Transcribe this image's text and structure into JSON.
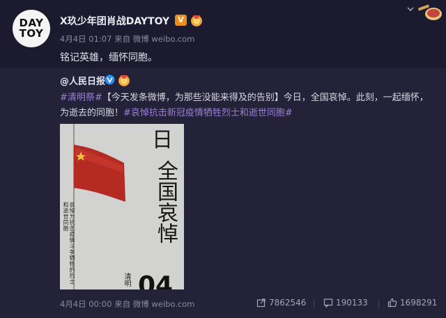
{
  "post": {
    "author": "X玖少年团肖战DAYTOY",
    "avatar_text_line1": "DAY",
    "avatar_text_line2": "TOY",
    "verified_badge": "V",
    "meta": "4月4日 01:07 来自 微博 weibo.com",
    "text": "铭记英雄，缅怀同胞。"
  },
  "repost": {
    "author": "@人民日报",
    "text_tag1": "#清明祭#",
    "text_body": "【今天发条微博，为那些没能来得及的告别】今日，全国哀悼。此刻，一起缅怀，为逝去的同胞！",
    "text_tag2": "#哀悼抗击新冠疫情牺牲烈士和逝世同胞#",
    "poster": {
      "top_char": "日",
      "headline": "全国哀悼",
      "subtitle": "哀悼为抗击疫情斗争牺牲的烈士和逝世同胞",
      "qingming": "清明",
      "number": "04"
    },
    "meta": "4月4日 00:00 来自 微博 weibo.com",
    "stats": {
      "reposts": "7862546",
      "comments": "190133",
      "likes": "1698291"
    }
  },
  "colors": {
    "background": "#1c1a2e",
    "repost_background": "#242238",
    "tag": "#9b7fd6",
    "verified_orange": "#f08c1a",
    "verified_blue": "#2d8cf0"
  },
  "icons": {
    "header_right": "chevron-down-icon",
    "decoration": "card-decoration-icon",
    "medal": "medal-icon",
    "repost": "repost-icon",
    "comment": "comment-icon",
    "like": "like-icon"
  }
}
